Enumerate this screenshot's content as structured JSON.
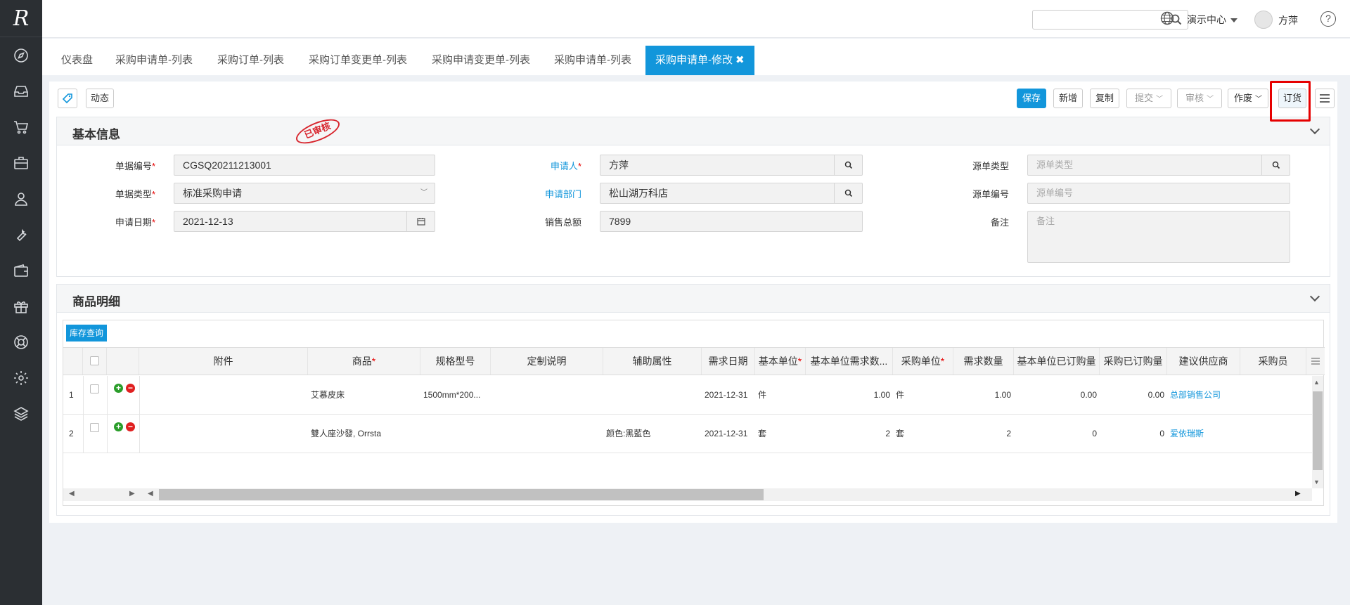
{
  "app": {
    "logo": "R"
  },
  "sidebar": {
    "items": [
      {
        "icon": "compass-icon"
      },
      {
        "icon": "inbox-icon"
      },
      {
        "icon": "cart-icon"
      },
      {
        "icon": "briefcase-icon"
      },
      {
        "icon": "user-icon"
      },
      {
        "icon": "wrench-icon"
      },
      {
        "icon": "wallet-icon"
      },
      {
        "icon": "gift-icon"
      },
      {
        "icon": "lifebuoy-icon"
      },
      {
        "icon": "settings-icon"
      },
      {
        "icon": "layers-icon"
      }
    ]
  },
  "topbar": {
    "search_placeholder": "",
    "org": "演示中心",
    "user": "方萍",
    "help": "?"
  },
  "tabs": [
    {
      "label": "仪表盘"
    },
    {
      "label": "采购申请单-列表"
    },
    {
      "label": "采购订单-列表"
    },
    {
      "label": "采购订单变更单-列表"
    },
    {
      "label": "采购申请变更单-列表"
    },
    {
      "label": "采购申请单-列表"
    },
    {
      "label": "采购申请单-修改",
      "active": true
    }
  ],
  "tab_close": "✖",
  "toolbar": {
    "dynamic": "动态",
    "save": "保存",
    "new": "新增",
    "copy": "复制",
    "submit": "提交",
    "audit": "审核",
    "void": "作废",
    "order": "订货"
  },
  "basic_info": {
    "title": "基本信息",
    "stamp": "已审核",
    "fields": {
      "doc_no": {
        "label": "单据编号",
        "value": "CGSQ20211213001"
      },
      "doc_type": {
        "label": "单据类型",
        "value": "标准采购申请"
      },
      "apply_date": {
        "label": "申请日期",
        "value": "2021-12-13"
      },
      "applicant": {
        "label": "申请人",
        "value": "方萍"
      },
      "dept": {
        "label": "申请部门",
        "value": "松山湖万科店"
      },
      "sales_total": {
        "label": "销售总额",
        "value": "7899"
      },
      "src_type": {
        "label": "源单类型",
        "placeholder": "源单类型"
      },
      "src_no": {
        "label": "源单编号",
        "placeholder": "源单编号"
      },
      "remark": {
        "label": "备注",
        "placeholder": "备注"
      }
    }
  },
  "details": {
    "title": "商品明细",
    "stock_query": "库存查询",
    "columns": [
      "附件",
      "商品",
      "规格型号",
      "定制说明",
      "辅助属性",
      "需求日期",
      "基本单位",
      "基本单位需求数...",
      "采购单位",
      "需求数量",
      "基本单位已订购量",
      "采购已订购量",
      "建议供应商",
      "采购员"
    ],
    "rows": [
      {
        "no": "1",
        "product": "艾慕皮床",
        "spec": "1500mm*200...",
        "custom": "",
        "aux": "",
        "date": "2021-12-31",
        "base_unit": "件",
        "base_qty": "1.00",
        "pur_unit": "件",
        "qty": "1.00",
        "base_ordered": "0.00",
        "pur_ordered": "0.00",
        "supplier": "总部销售公司",
        "buyer": ""
      },
      {
        "no": "2",
        "product": "雙人座沙發, Orrsta",
        "spec": "",
        "custom": "",
        "aux": "颜色:黑藍色",
        "date": "2021-12-31",
        "base_unit": "套",
        "base_qty": "2",
        "pur_unit": "套",
        "qty": "2",
        "base_ordered": "0",
        "pur_ordered": "0",
        "supplier": "爱依瑞斯",
        "buyer": ""
      }
    ]
  }
}
